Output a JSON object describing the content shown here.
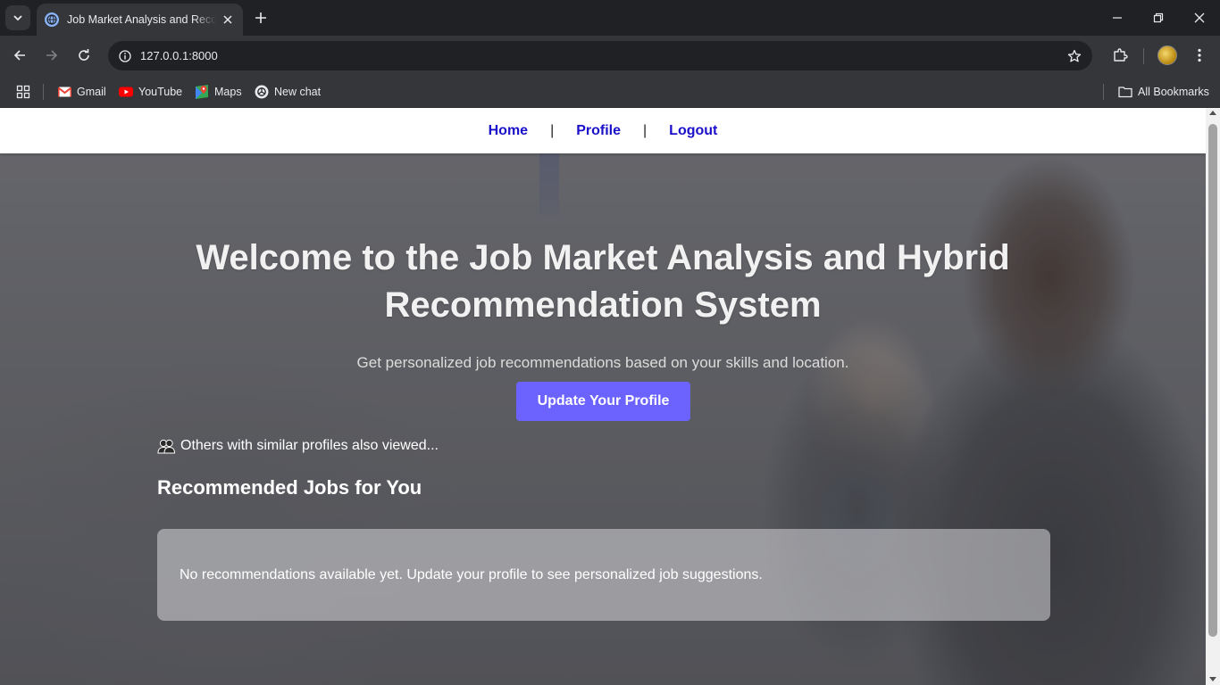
{
  "browser": {
    "tab_title": "Job Market Analysis and Recommendation System",
    "url": "127.0.0.1:8000",
    "bookmarks": [
      {
        "label": "Gmail",
        "icon": "gmail-icon"
      },
      {
        "label": "YouTube",
        "icon": "youtube-icon"
      },
      {
        "label": "Maps",
        "icon": "maps-icon"
      },
      {
        "label": "New chat",
        "icon": "chatgpt-icon"
      }
    ],
    "all_bookmarks": "All Bookmarks"
  },
  "site_nav": {
    "home": "Home",
    "separator": "|",
    "profile": "Profile",
    "logout": "Logout"
  },
  "hero": {
    "title": "Welcome to the Job Market Analysis and Hybrid Recommendation System",
    "subtitle": "Get personalized job recommendations based on your skills and location.",
    "cta": "Update Your Profile"
  },
  "recommendations": {
    "similar_text": "Others with similar profiles also viewed...",
    "heading": "Recommended Jobs for You",
    "empty_message": "No recommendations available yet. Update your profile to see personalized job suggestions."
  },
  "colors": {
    "accent": "#6c63ff",
    "nav_link": "#1a10c9",
    "chrome_dark": "#202124",
    "chrome_toolbar": "#35363a"
  }
}
